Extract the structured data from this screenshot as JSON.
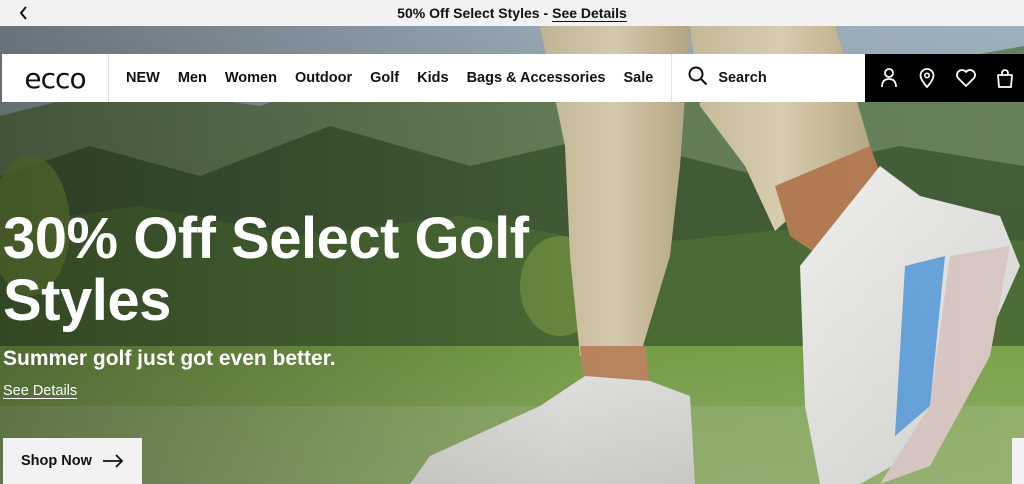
{
  "promo": {
    "text": "50% Off Select Styles -",
    "link": "See Details",
    "back_icon": "chevron-left-icon"
  },
  "nav": {
    "logo": "ecco",
    "menu": [
      "NEW",
      "Men",
      "Women",
      "Outdoor",
      "Golf",
      "Kids",
      "Bags & Accessories",
      "Sale"
    ],
    "search_label": "Search",
    "icons": [
      "account-icon",
      "location-pin-icon",
      "heart-icon",
      "bag-icon"
    ]
  },
  "hero": {
    "headline": "30% Off Select Golf Styles",
    "subhead": "Summer golf just got even better.",
    "details_link": "See Details",
    "cta": "Shop Now",
    "cta_icon": "arrow-right-icon"
  },
  "colors": {
    "promo_bg": "#f2f2f2",
    "icons_bar_bg": "#000000",
    "text_dark": "#111111",
    "hero_text": "#ffffff"
  }
}
